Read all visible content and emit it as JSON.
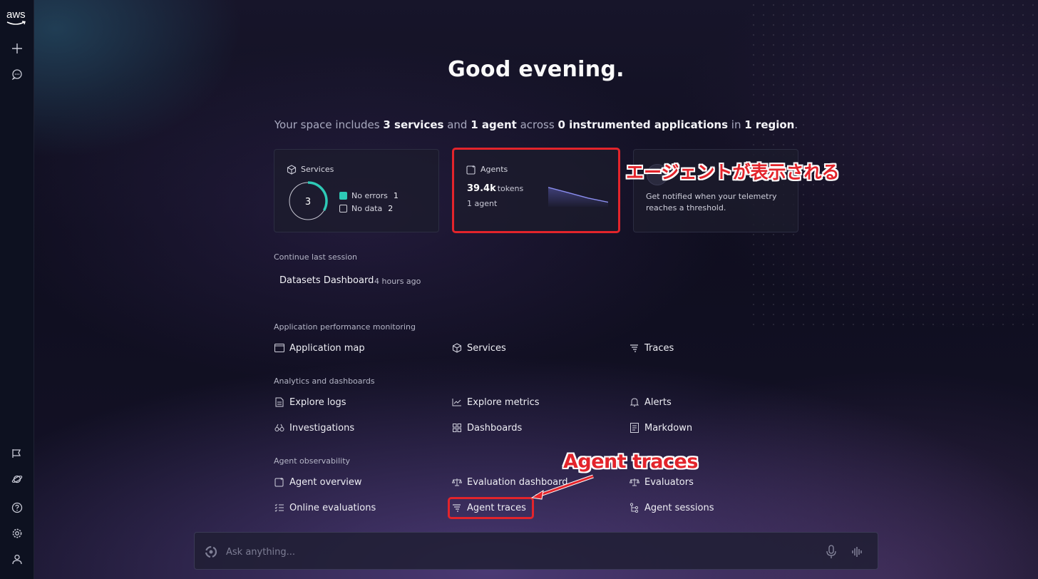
{
  "brand": {
    "logo_text": "aws"
  },
  "sidebar": {
    "top_items": [
      {
        "icon": "plus-icon"
      },
      {
        "icon": "chat-icon"
      }
    ],
    "bottom_items": [
      {
        "icon": "announcement-icon"
      },
      {
        "icon": "planet-icon"
      },
      {
        "icon": "help-icon"
      },
      {
        "icon": "settings-gear-icon"
      },
      {
        "icon": "user-icon"
      }
    ]
  },
  "greeting": "Good evening.",
  "summary": {
    "prefix": "Your space includes",
    "services": "3 services",
    "and": "and",
    "agents": "1 agent",
    "across": "across",
    "apps": "0 instrumented applications",
    "in": "in",
    "regions": "1 region",
    "period": "."
  },
  "cards": {
    "services": {
      "title": "Services",
      "total": "3",
      "ratio_no_errors": 0.333,
      "legend": [
        {
          "label": "No errors",
          "count": "1",
          "color": "#2ec9b6"
        },
        {
          "label": "No data",
          "count": "2"
        }
      ]
    },
    "agents": {
      "title": "Agents",
      "tokens_value": "39.4k",
      "tokens_unit": "tokens",
      "agent_count": "1 agent",
      "sparkline": [
        0.85,
        0.62,
        0.38,
        0.2
      ]
    },
    "alerts": {
      "description": "Get notified when your telemetry reaches a threshold."
    }
  },
  "continue_session": {
    "heading": "Continue last session",
    "name": "Datasets Dashboard",
    "time": "4 hours ago"
  },
  "sections": {
    "apm": {
      "heading": "Application performance monitoring",
      "links": [
        "Application map",
        "Services",
        "Traces"
      ]
    },
    "analytics": {
      "heading": "Analytics and dashboards",
      "links": [
        "Explore logs",
        "Explore metrics",
        "Alerts",
        "Investigations",
        "Dashboards",
        "Markdown"
      ]
    },
    "agent_obs": {
      "heading": "Agent observability",
      "links": [
        "Agent overview",
        "Evaluation dashboard",
        "Evaluators",
        "Online evaluations",
        "Agent traces",
        "Agent sessions"
      ]
    }
  },
  "chat": {
    "placeholder": "Ask anything..."
  },
  "annotations": {
    "agents_note": "エージェントが表示される",
    "traces_note": "Agent traces",
    "color": "#e3242b"
  }
}
